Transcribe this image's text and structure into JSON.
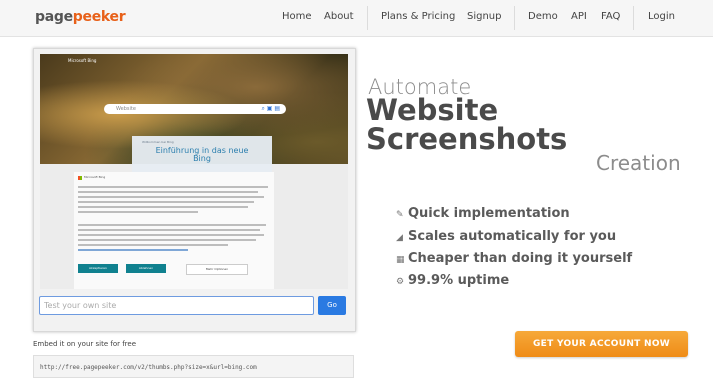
{
  "header": {
    "logo_part1": "page",
    "logo_part2": "peeker",
    "nav": [
      "Home",
      "About",
      "Plans & Pricing",
      "Signup",
      "Demo",
      "API",
      "FAQ",
      "Login"
    ]
  },
  "preview": {
    "bing_logo": "Microsoft Bing",
    "search_placeholder": "Website",
    "search_icons": "⌕ ▣ ▤",
    "card_kicker": "Willkommen bei Bing",
    "card_title_line1": "Einführung in das neue",
    "card_title_line2": "Bing",
    "consent_brand": "Microsoft Bing",
    "btn_accept": "Akzeptieren",
    "btn_reject": "Ablehnen",
    "btn_manage": "Mehr Optionen"
  },
  "test_form": {
    "placeholder": "Test your own site",
    "go_label": "Go"
  },
  "embed": {
    "label": "Embed it on your site for free",
    "code": "http://free.pagepeeker.com/v2/thumbs.php?size=x&url=bing.com"
  },
  "headline": {
    "automate": "Automate",
    "website": "Website",
    "screenshots": "Screenshots",
    "creation": "Creation"
  },
  "features": [
    {
      "icon": "pencil-icon",
      "glyph": "✎",
      "text": "Quick implementation"
    },
    {
      "icon": "scale-icon",
      "glyph": "◢",
      "text": "Scales automatically for you"
    },
    {
      "icon": "grid-icon",
      "glyph": "▦",
      "text": "Cheaper than doing it yourself"
    },
    {
      "icon": "uptime-icon",
      "glyph": "⚙",
      "text": "99.9% uptime"
    }
  ],
  "cta": {
    "label": "GET YOUR ACCOUNT NOW"
  },
  "colors": {
    "brand_orange": "#e8611a",
    "cta_orange": "#f29a25",
    "go_blue": "#2a7ae2",
    "teal_button": "#10818f"
  }
}
